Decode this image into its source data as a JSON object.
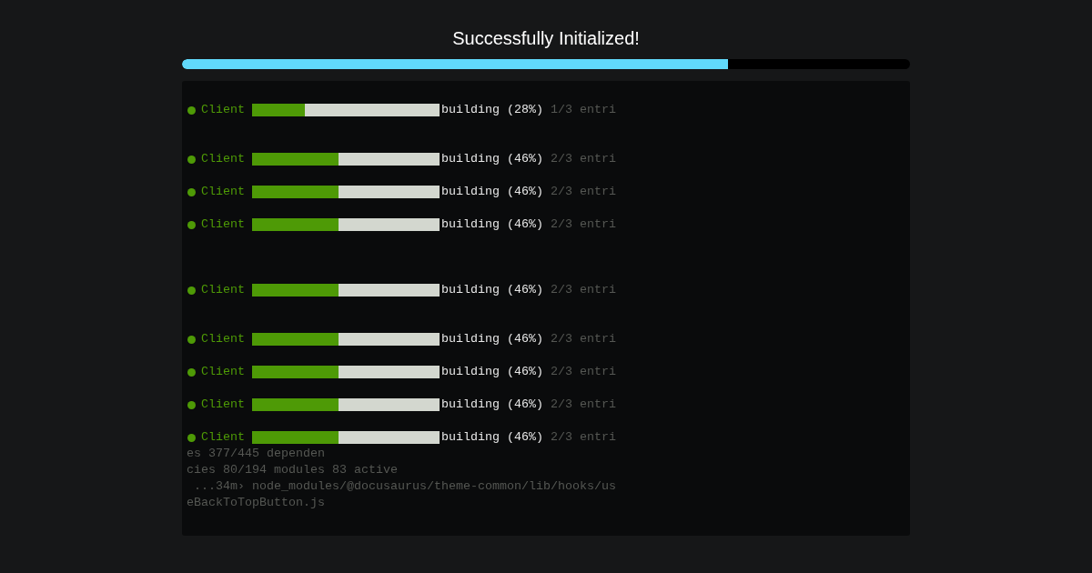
{
  "title": "Successfully Initialized!",
  "progress": {
    "level": 0.75
  },
  "terminal": {
    "lines": [
      {
        "kind": "progress",
        "name": "Client",
        "level": 0.28,
        "status": "building (28%)",
        "detail": "1/3 entri"
      },
      {
        "kind": "blank"
      },
      {
        "kind": "blank"
      },
      {
        "kind": "progress",
        "name": "Client",
        "level": 0.46,
        "status": "building (46%)",
        "detail": "2/3 entri"
      },
      {
        "kind": "blank"
      },
      {
        "kind": "progress",
        "name": "Client",
        "level": 0.46,
        "status": "building (46%)",
        "detail": "2/3 entri"
      },
      {
        "kind": "blank"
      },
      {
        "kind": "progress",
        "name": "Client",
        "level": 0.46,
        "status": "building (46%)",
        "detail": "2/3 entri"
      },
      {
        "kind": "blank"
      },
      {
        "kind": "blank"
      },
      {
        "kind": "blank"
      },
      {
        "kind": "progress",
        "name": "Client",
        "level": 0.46,
        "status": "building (46%)",
        "detail": "2/3 entri"
      },
      {
        "kind": "blank"
      },
      {
        "kind": "blank"
      },
      {
        "kind": "progress",
        "name": "Client",
        "level": 0.46,
        "status": "building (46%)",
        "detail": "2/3 entri"
      },
      {
        "kind": "blank"
      },
      {
        "kind": "progress",
        "name": "Client",
        "level": 0.46,
        "status": "building (46%)",
        "detail": "2/3 entri"
      },
      {
        "kind": "blank"
      },
      {
        "kind": "progress",
        "name": "Client",
        "level": 0.46,
        "status": "building (46%)",
        "detail": "2/3 entri"
      },
      {
        "kind": "blank"
      },
      {
        "kind": "progress",
        "name": "Client",
        "level": 0.46,
        "status": "building (46%)",
        "detail": "2/3 entri"
      },
      {
        "kind": "text",
        "text": "es 377/445 dependen"
      },
      {
        "kind": "text",
        "text": "cies 80/194 modules 83 active"
      },
      {
        "kind": "text",
        "text": " ...34m› node_modules/@docusaurus/theme-common/lib/hooks/us"
      },
      {
        "kind": "text",
        "text": "eBackToTopButton.js"
      }
    ]
  }
}
